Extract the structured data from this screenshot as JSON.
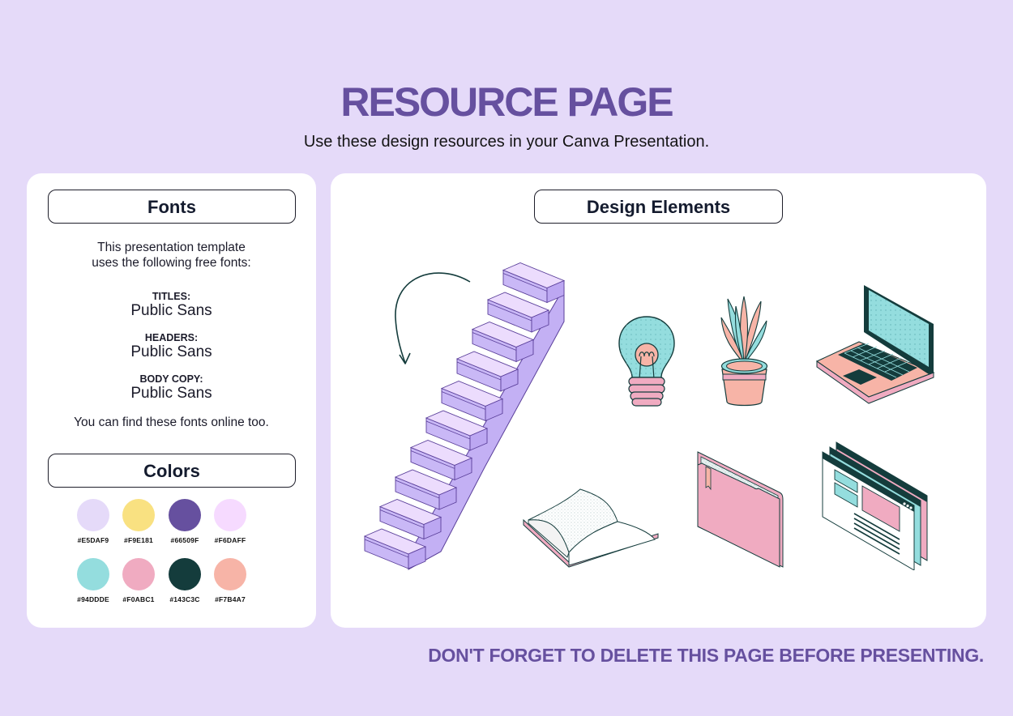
{
  "page": {
    "title": "RESOURCE PAGE",
    "subtitle": "Use these design resources in your Canva Presentation.",
    "footer_note": "DON'T FORGET TO DELETE THIS PAGE BEFORE PRESENTING."
  },
  "fonts_panel": {
    "heading": "Fonts",
    "intro_line1": "This presentation template",
    "intro_line2": "uses the following free fonts:",
    "entries": [
      {
        "label": "TITLES:",
        "font": "Public Sans"
      },
      {
        "label": "HEADERS:",
        "font": "Public Sans"
      },
      {
        "label": "BODY COPY:",
        "font": "Public Sans"
      }
    ],
    "outro": "You can find these fonts online too."
  },
  "colors_panel": {
    "heading": "Colors",
    "swatches": [
      {
        "hex": "#E5DAF9",
        "label": "#E5DAF9"
      },
      {
        "hex": "#F9E181",
        "label": "#F9E181"
      },
      {
        "hex": "#66509F",
        "label": "#66509F"
      },
      {
        "hex": "#F6DAFF",
        "label": "#F6DAFF"
      },
      {
        "hex": "#94DDDE",
        "label": "#94DDDE"
      },
      {
        "hex": "#F0ABC1",
        "label": "#F0ABC1"
      },
      {
        "hex": "#143C3C",
        "label": "#143C3C"
      },
      {
        "hex": "#F7B4A7",
        "label": "#F7B4A7"
      }
    ]
  },
  "design_panel": {
    "heading": "Design Elements",
    "elements": [
      {
        "icon": "staircase-icon",
        "steps": 10
      },
      {
        "icon": "curved-arrow-icon"
      },
      {
        "icon": "lightbulb-icon"
      },
      {
        "icon": "potted-plant-icon"
      },
      {
        "icon": "laptop-icon"
      },
      {
        "icon": "open-book-icon"
      },
      {
        "icon": "folder-icon"
      },
      {
        "icon": "browser-windows-icon"
      }
    ]
  }
}
